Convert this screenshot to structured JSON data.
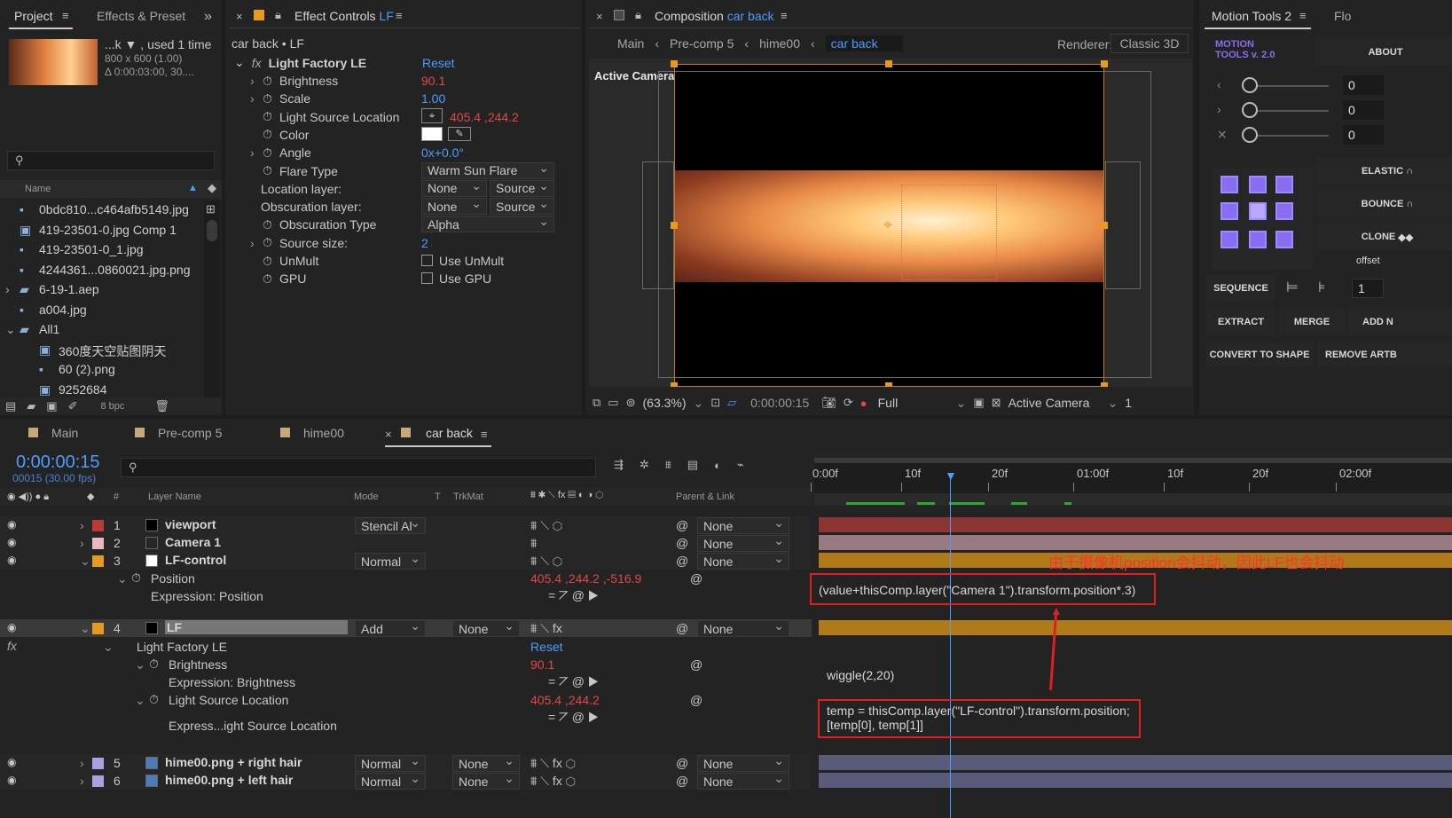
{
  "project": {
    "tab": "Project",
    "effects_tab": "Effects & Preset",
    "comp_name": "...k ▼ , used 1 time",
    "info1": "800 x 600 (1.00)",
    "info2": "Δ 0:00:03:00, 30....",
    "col_name": "Name",
    "files": [
      "0bdc810...c464afb5149.jpg",
      "419-23501-0.jpg Comp 1",
      "419-23501-0_1.jpg",
      "4244361...0860021.jpg.png",
      "6-19-1.aep",
      "a004.jpg",
      "All1",
      "360度天空贴图阴天",
      "60 (2).png",
      "9252684"
    ],
    "bpc": "8 bpc"
  },
  "effect": {
    "tab_prefix": "Effect Controls",
    "tab_layer": "LF",
    "header": "car back • LF",
    "fx_name": "Light Factory LE",
    "reset": "Reset",
    "props": [
      {
        "name": "Brightness",
        "value": "90.1"
      },
      {
        "name": "Scale",
        "value": "1.00"
      },
      {
        "name": "Light Source Location",
        "value": "405.4 ,244.2"
      },
      {
        "name": "Color",
        "value": ""
      },
      {
        "name": "Angle",
        "value": "0x+0.0°"
      },
      {
        "name": "Flare Type",
        "value": "Warm Sun Flare"
      },
      {
        "name": "Location layer:",
        "value": "None",
        "value2": "Source"
      },
      {
        "name": "Obscuration layer:",
        "value": "None",
        "value2": "Source"
      },
      {
        "name": "Obscuration Type",
        "value": "Alpha"
      },
      {
        "name": "Source size:",
        "value": "2"
      },
      {
        "name": "UnMult",
        "value": "Use UnMult"
      },
      {
        "name": "GPU",
        "value": "Use GPU"
      }
    ]
  },
  "comp": {
    "tab_prefix": "Composition",
    "tab_comp": "car back",
    "breadcrumbs": [
      "Main",
      "Pre-comp 5",
      "hime00",
      "car back"
    ],
    "renderer_label": "Renderer:",
    "renderer": "Classic 3D",
    "view_label": "Active Camera",
    "zoom": "(63.3%)",
    "time": "0:00:00:15",
    "quality": "Full",
    "camera": "Active Camera",
    "views": "1"
  },
  "motion": {
    "tab": "Motion Tools 2",
    "tab2": "Flo",
    "logo1": "MOTION",
    "logo2": "TOOLS v. 2.0",
    "about": "ABOUT",
    "sliders": [
      "0",
      "0",
      "0"
    ],
    "elastic": "ELASTIC",
    "bounce": "BOUNCE",
    "clone": "CLONE",
    "offset": "offset",
    "sequence": "SEQUENCE",
    "seq_val": "1",
    "extract": "EXTRACT",
    "merge": "MERGE",
    "addn": "ADD N",
    "convert": "CONVERT TO SHAPE",
    "remove": "REMOVE ARTB"
  },
  "timeline": {
    "tabs": [
      "Main",
      "Pre-comp 5",
      "hime00",
      "car back"
    ],
    "timecode": "0:00:00:15",
    "frames": "00015 (30.00 fps)",
    "col_layer": "Layer Name",
    "col_mode": "Mode",
    "col_t": "T",
    "col_trkmat": "TrkMat",
    "col_parent": "Parent & Link",
    "ruler": [
      "0:00f",
      "10f",
      "20f",
      "01:00f",
      "10f",
      "20f",
      "02:00f"
    ],
    "layers": [
      {
        "num": "1",
        "name": "viewport",
        "mode": "Stencil Al",
        "trk": "",
        "parent": "None",
        "color": "#b83a3a"
      },
      {
        "num": "2",
        "name": "Camera 1",
        "mode": "",
        "trk": "",
        "parent": "None",
        "color": "#e8b8c0"
      },
      {
        "num": "3",
        "name": "LF-control",
        "mode": "Normal",
        "trk": "",
        "parent": "None",
        "color": "#e89a20"
      },
      {
        "num": "4",
        "name": "LF",
        "mode": "Add",
        "trk": "None",
        "parent": "None",
        "color": "#e89a20"
      },
      {
        "num": "5",
        "name": "hime00.png + right hair",
        "mode": "Normal",
        "trk": "None",
        "parent": "None",
        "color": "#a8a0e0"
      },
      {
        "num": "6",
        "name": "hime00.png + left hair",
        "mode": "Normal",
        "trk": "None",
        "parent": "None",
        "color": "#a8a0e0"
      }
    ],
    "position_label": "Position",
    "position_value": "405.4 ,244.2 ,-516.9",
    "expr_position_label": "Expression: Position",
    "fx_label": "Light Factory LE",
    "fx_reset": "Reset",
    "brightness_label": "Brightness",
    "brightness_value": "90.1",
    "expr_brightness_label": "Expression: Brightness",
    "lsl_label": "Light Source Location",
    "lsl_value": "405.4 ,244.2",
    "expr_lsl_label": "Express...ight Source Location",
    "expr1": "(value+thisComp.layer(\"Camera  1\").transform.position*.3)",
    "expr2": "wiggle(2,20)",
    "expr3a": "temp = thisComp.layer(\"LF-control\").transform.position;",
    "expr3b": "[temp[0], temp[1]]",
    "note": "由于摄像机position会抖动，因此LF也会抖动"
  }
}
